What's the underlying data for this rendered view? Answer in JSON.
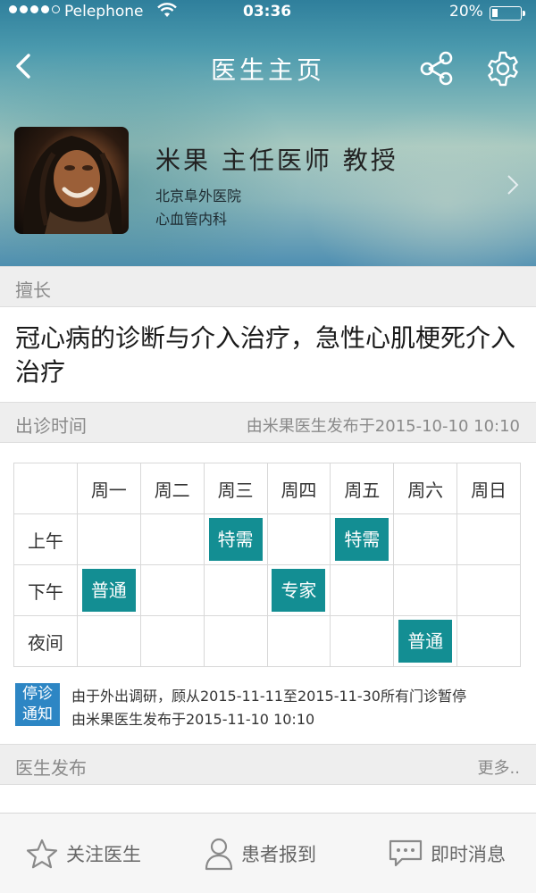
{
  "status_bar": {
    "carrier": "Pelephone",
    "time": "03:36",
    "battery_percent": "20%",
    "battery_level": 0.2
  },
  "nav": {
    "title": "医生主页"
  },
  "doctor": {
    "name_title": "米果 主任医师 教授",
    "hospital": "北京阜外医院",
    "department": "心血管内科"
  },
  "specialty": {
    "label": "擅长",
    "text": "冠心病的诊断与介入治疗，急性心肌梗死介入治疗"
  },
  "schedule": {
    "label": "出诊时间",
    "published": "由米果医生发布于2015-10-10 10:10",
    "days": [
      "周一",
      "周二",
      "周三",
      "周四",
      "周五",
      "周六",
      "周日"
    ],
    "rows": [
      {
        "label": "上午",
        "cells": [
          "",
          "",
          "特需",
          "",
          "特需",
          "",
          ""
        ]
      },
      {
        "label": "下午",
        "cells": [
          "普通",
          "",
          "",
          "专家",
          "",
          "",
          ""
        ]
      },
      {
        "label": "夜间",
        "cells": [
          "",
          "",
          "",
          "",
          "",
          "普通",
          ""
        ]
      }
    ]
  },
  "notice": {
    "badge_line1": "停诊",
    "badge_line2": "通知",
    "text": "由于外出调研，顾从2015-11-11至2015-11-30所有门诊暂停",
    "published": "由米果医生发布于2015-11-10 10:10"
  },
  "posts": {
    "label": "医生发布",
    "more": "更多.."
  },
  "tabs": {
    "follow": "关注医生",
    "report": "患者报到",
    "message": "即时消息"
  },
  "colors": {
    "accent": "#138e93",
    "notice_badge": "#2d86c4",
    "section_bg": "#eeeeee"
  },
  "icons": [
    "back-arrow-icon",
    "share-icon",
    "gear-icon",
    "chevron-right-icon",
    "star-icon",
    "person-icon",
    "chat-bubble-icon"
  ]
}
